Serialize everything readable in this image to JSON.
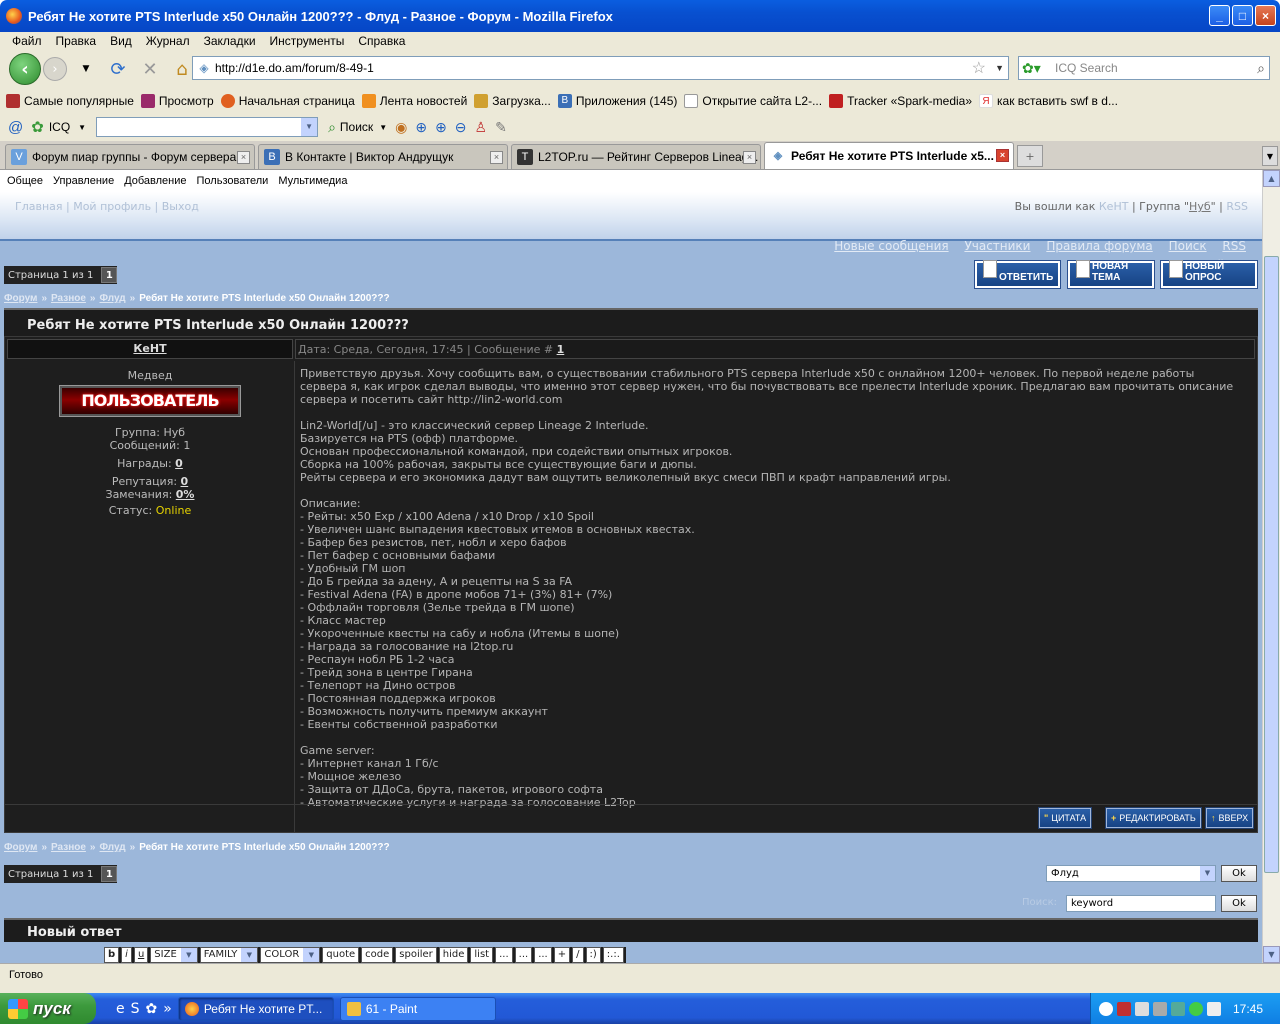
{
  "window": {
    "title": "Ребят Не хотите PTS Interlude x50 Онлайн 1200??? - Флуд - Разное - Форум - Mozilla Firefox"
  },
  "menu": [
    "Файл",
    "Правка",
    "Вид",
    "Журнал",
    "Закладки",
    "Инструменты",
    "Справка"
  ],
  "address": {
    "url": "http://d1e.do.am/forum/8-49-1"
  },
  "search": {
    "placeholder": "ICQ Search"
  },
  "bookmarks": [
    {
      "label": "Самые популярные",
      "color": "#b03030"
    },
    {
      "label": "Просмотр",
      "color": "#9a2a6a"
    },
    {
      "label": "Начальная страница",
      "color": "#e06020"
    },
    {
      "label": "Лента новостей",
      "color": "#f09020"
    },
    {
      "label": "Загрузка...",
      "color": "#d0a030"
    },
    {
      "label": "Приложения (145)",
      "color": "#3b6fb6"
    },
    {
      "label": "Открытие сайта L2-...",
      "color": "#ffffff"
    },
    {
      "label": "Tracker «Spark-media»",
      "color": "#c02020"
    },
    {
      "label": "как вставить swf в d...",
      "color": "#e03030"
    }
  ],
  "icqbar": {
    "icq_label": "ICQ",
    "search_btn": "Поиск"
  },
  "tabs": [
    {
      "label": "Форум пиар группы - Форум сервера ...",
      "color": "#6aa0dc",
      "active": false
    },
    {
      "label": "В Контакте | Виктор Андрущук",
      "color": "#3b6fb6",
      "active": false
    },
    {
      "label": "L2TOP.ru — Рейтинг Серверов Lineag...",
      "color": "#333",
      "active": false
    },
    {
      "label": "Ребят Не хотите PTS Interlude x5...",
      "color": "#9cb7da",
      "active": true
    }
  ],
  "ucp_menu": [
    "Общее",
    "Управление",
    "Добавление",
    "Пользователи",
    "Мультимедиа"
  ],
  "header": {
    "left": "Главная | Мой профиль | Выход",
    "logged_prefix": "Вы вошли как",
    "user": "КеНТ",
    "group_prefix": "| Группа \"",
    "group": "Нуб",
    "group_suffix": "\" |",
    "rss": "RSS"
  },
  "forum_links": [
    "Новые сообщения",
    "Участники",
    "Правила форума",
    "Поиск",
    "RSS"
  ],
  "pager": {
    "label": "Страница 1 из 1",
    "page": "1"
  },
  "buttons": {
    "reply": "ОТВЕТИТЬ",
    "new_topic": "НОВАЯ ТЕМА",
    "new_poll": "НОВЫЙ ОПРОС"
  },
  "breadcrumb": {
    "forum": "Форум",
    "section": "Разное",
    "subforum": "Флуд",
    "sep": "»",
    "current": "Ребят Не хотите PTS Interlude x50 Онлайн 1200???"
  },
  "topic": {
    "title": "Ребят Не хотите PTS Interlude x50 Онлайн 1200???"
  },
  "post": {
    "author": "КеНТ",
    "meta": "Дата: Среда, Сегодня, 17:45 | Сообщение #",
    "num": "1",
    "rank_title": "Медвед",
    "rank_image_text": "ПОЛЬЗОВАТЕЛЬ",
    "group": "Группа: Нуб",
    "messages": "Сообщений: 1",
    "awards_label": "Награды:",
    "awards": "0",
    "reputation_label": "Репутация:",
    "reputation": "0",
    "warnings_label": "Замечания:",
    "warnings": "0%",
    "status_label": "Статус:",
    "status": "Online",
    "body": "Приветствую друзья. Хочу сообщить вам, о существовании стабильного PTS сервера Interlude x50 с онлайном 1200+ человек. По первой неделе работы\nсервера я, как игрок сделал выводы, что именно этот сервер нужен, что бы почувствовать все прелести Interlude хроник. Предлагаю вам прочитать описание\nсервера и посетить сайт http://lin2-world.com\n\nLin2-World[/u] - это классический сервер Lineage 2 Interlude.\nБазируется на PTS (офф) платформе.\nОснован профессиональной командой, при содействии опытных игроков.\nСборка на 100% рабочая, закрыты все существующие баги и дюпы.\nРейты сервера и его экономика дадут вам ощутить великолепный вкус смеси ПВП и крафт направлений игры.\n\nОписание:\n- Рейты: x50 Exp / x100 Adena / x10 Drop / x10 Spoil\n- Увеличен шанс выпадения квестовых итемов в основных квестах.\n- Бафер без резистов, пет, нобл и херо бафов\n- Пет бафер с основными бафами\n- Удобный ГМ шоп\n- До Б грейда за адену, А и рецепты на S за FA\n- Festival Adena (FA) в дропе мобов 71+ (3%) 81+ (7%)\n- Оффлайн торговля (Зелье трейда в ГМ шопе)\n- Класс мастер\n- Укороченные квесты на сабу и нобла (Итемы в шопе)\n- Награда за голосование на l2top.ru\n- Респаун нобл РБ 1-2 часа\n- Трейд зона в центре Гирана\n- Телепорт на Дино остров\n- Постоянная поддержка игроков\n- Возможность получить премиум аккаунт\n- Евенты собственной разработки\n\nGame server:\n- Интернет канал 1 Гб/с\n- Мощное железо\n- Защита от ДДоСа, брута, пакетов, игрового софта\n- Автоматические услуги и награда за голосование L2Top"
  },
  "post_buttons": {
    "quote": "ЦИТАТА",
    "edit": "РЕДАКТИРОВАТЬ",
    "up": "ВВЕРХ"
  },
  "jump": {
    "selected": "Флуд",
    "ok": "Ok"
  },
  "forum_search": {
    "label": "Поиск:",
    "value": "keyword",
    "ok": "Ok"
  },
  "new_reply": {
    "title": "Новый ответ"
  },
  "bbcodes": [
    "b",
    "i",
    "u",
    "SIZE",
    "FAMILY",
    "COLOR",
    "quote",
    "code",
    "spoiler",
    "hide",
    "list",
    "...",
    "...",
    "...",
    "+",
    "/",
    ":)",
    ":.:."
  ],
  "statusbar": {
    "text": "Готово"
  },
  "taskbar": {
    "start": "пуск",
    "tasks": [
      {
        "label": "Ребят Не хотите PT...",
        "active": true
      },
      {
        "label": "61 - Paint",
        "active": false
      }
    ],
    "lang": "EN",
    "time": "17:45"
  }
}
